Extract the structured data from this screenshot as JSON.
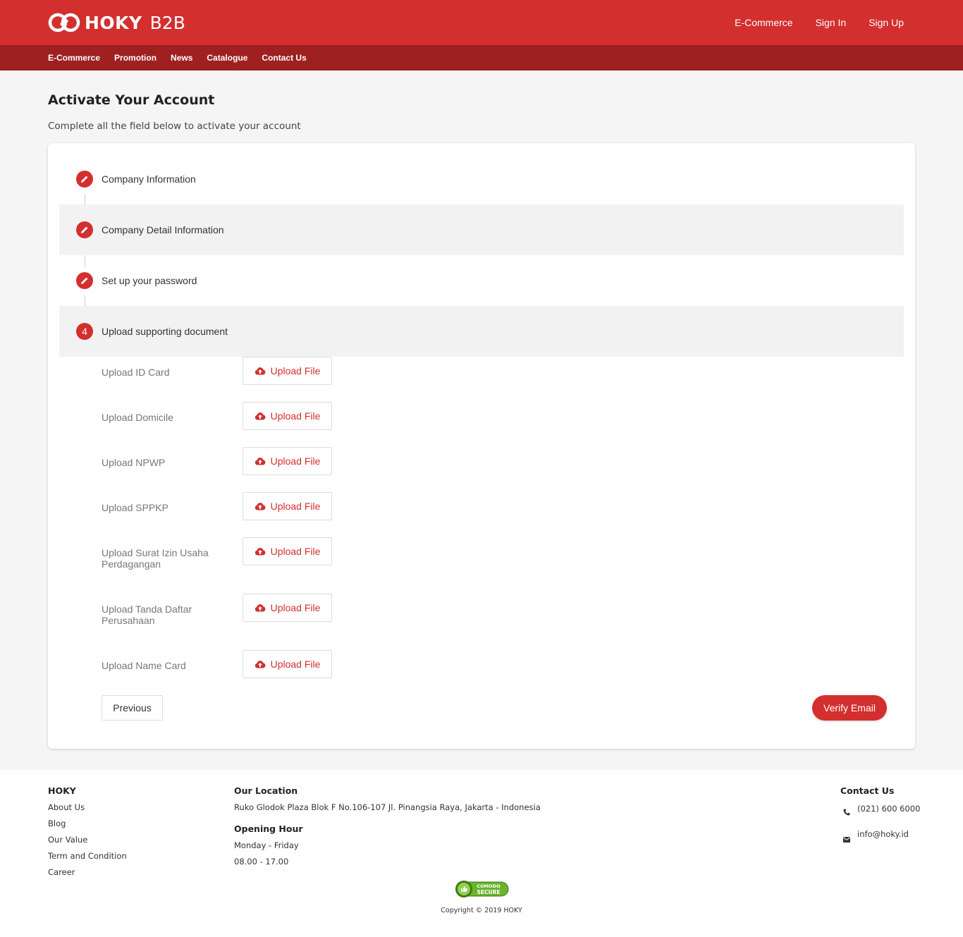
{
  "brand": {
    "name": "HOKY",
    "suffix": "B2B",
    "logo_icon": "infinity-logo-icon"
  },
  "header": {
    "links": [
      "E-Commerce",
      "Sign In",
      "Sign Up"
    ]
  },
  "nav": {
    "items": [
      "E-Commerce",
      "Promotion",
      "News",
      "Catalogue",
      "Contact Us"
    ]
  },
  "page": {
    "title": "Activate Your Account",
    "subtitle": "Complete all the field below to activate your account"
  },
  "steps": [
    {
      "label": "Company Information",
      "icon": "pencil-icon"
    },
    {
      "label": "Company Detail Information",
      "icon": "pencil-icon"
    },
    {
      "label": "Set up your password",
      "icon": "pencil-icon"
    },
    {
      "label": "Upload supporting document",
      "number": "4"
    }
  ],
  "uploads": {
    "button_label": "Upload File",
    "button_icon": "cloud-upload-icon",
    "items": [
      "Upload ID Card",
      "Upload Domicile",
      "Upload NPWP",
      "Upload SPPKP",
      "Upload Surat Izin Usaha Perdagangan",
      "Upload Tanda Daftar Perusahaan",
      "Upload Name Card"
    ]
  },
  "actions": {
    "previous": "Previous",
    "verify": "Verify Email"
  },
  "footer": {
    "col1": {
      "title": "HOKY",
      "links": [
        "About Us",
        "Blog",
        "Our Value",
        "Term and Condition",
        "Career"
      ]
    },
    "col2": {
      "location_title": "Our Location",
      "address": "Ruko Glodok Plaza Blok F No.106-107 Jl. Pinangsia Raya, Jakarta - Indonesia",
      "hours_title": "Opening Hour",
      "days": "Monday - Friday",
      "hours": "08.00 - 17.00"
    },
    "col3": {
      "title": "Contact Us",
      "phone": "(021) 600 6000",
      "email": "info@hoky.id"
    },
    "badge": {
      "line1": "COMODO",
      "line2": "SECURE"
    },
    "copyright": "Copyright © 2019 HOKY"
  },
  "colors": {
    "primary": "#d32f2f",
    "subnav": "#9e2020",
    "background": "#f5f5f5"
  }
}
